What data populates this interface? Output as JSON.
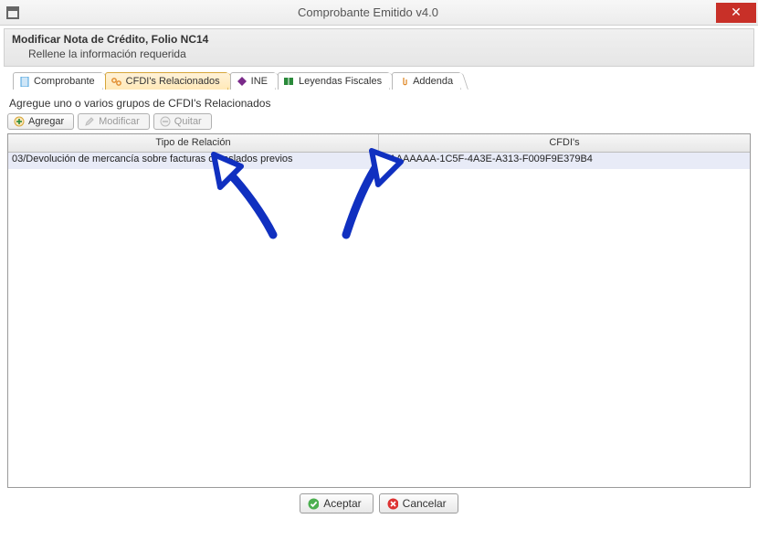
{
  "window": {
    "title": "Comprobante Emitido v4.0",
    "close_glyph": "✕"
  },
  "header": {
    "title": "Modificar Nota de Crédito, Folio NC14",
    "subtitle": "Rellene la información requerida"
  },
  "tabs": [
    {
      "label": "Comprobante",
      "icon": "doc-icon",
      "icon_color": "#4aa3df"
    },
    {
      "label": "CFDI's Relacionados",
      "icon": "chain-icon",
      "icon_color": "#e08a2a",
      "active": true
    },
    {
      "label": "INE",
      "icon": "diamond-icon",
      "icon_color": "#7a2a8a"
    },
    {
      "label": "Leyendas Fiscales",
      "icon": "book-icon",
      "icon_color": "#2a8a3a"
    },
    {
      "label": "Addenda",
      "icon": "attach-icon",
      "icon_color": "#e08a2a"
    }
  ],
  "instruction": "Agregue uno o varios grupos de CFDI's Relacionados",
  "toolbar": {
    "add": "Agregar",
    "modify": "Modificar",
    "remove": "Quitar"
  },
  "grid": {
    "columns": {
      "tipo": "Tipo de Relación",
      "cfdis": "CFDI's"
    },
    "rows": [
      {
        "tipo": "03/Devolución de mercancía sobre facturas o traslados previos",
        "cfdis": "AAAAAAAA-1C5F-4A3E-A313-F009F9E379B4"
      }
    ]
  },
  "footer": {
    "accept": "Aceptar",
    "cancel": "Cancelar"
  }
}
